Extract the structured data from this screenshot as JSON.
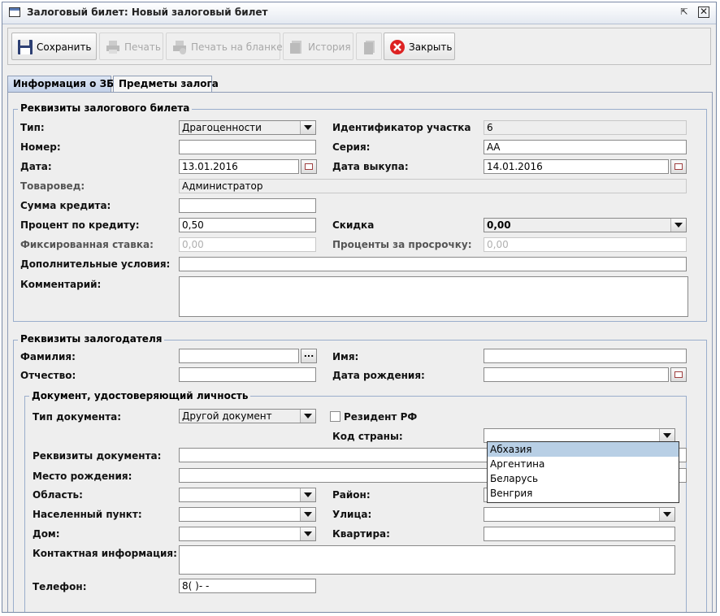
{
  "window": {
    "title": "Залоговый билет:  Новый залоговый билет"
  },
  "toolbar": {
    "save": "Сохранить",
    "print": "Печать",
    "print_form": "Печать на бланке",
    "history": "История",
    "close": "Закрыть"
  },
  "tabs": [
    "Информация о ЗБ",
    "Предметы залога"
  ],
  "ticket": {
    "legend": "Реквизиты залогового билета",
    "type_label": "Тип:",
    "type_value": "Драгоценности",
    "site_label": "Идентификатор участка",
    "site_value": "6",
    "number_label": "Номер:",
    "number_value": "",
    "series_label": "Серия:",
    "series_value": "АА",
    "date_label": "Дата:",
    "date_value": "13.01.2016",
    "buyback_label": "Дата выкупа:",
    "buyback_value": "14.01.2016",
    "merch_label": "Товаровед:",
    "merch_value": "Администратор",
    "credit_label": "Сумма кредита:",
    "credit_value": "",
    "percent_label": "Процент по кредиту:",
    "percent_value": "0,50",
    "discount_label": "Скидка",
    "discount_value": "0,00",
    "fixed_label": "Фиксированная ставка:",
    "fixed_value": "0,00",
    "overdue_label": "Проценты за просрочку:",
    "overdue_value": "0,00",
    "extra_label": "Дополнительные условия:",
    "extra_value": "",
    "comment_label": "Комментарий:",
    "comment_value": ""
  },
  "pledger": {
    "legend": "Реквизиты залогодателя",
    "surname_label": "Фамилия:",
    "surname_value": "",
    "lookup_label": "...",
    "name_label": "Имя:",
    "name_value": "",
    "patronymic_label": "Отчество:",
    "patronymic_value": "",
    "birth_label": "Дата рождения:",
    "birth_value": "",
    "doc": {
      "legend": "Документ, удостоверяющий личность",
      "doctype_label": "Тип документа:",
      "doctype_value": "Другой документ",
      "resident_label": "Резидент РФ",
      "country_label": "Код страны:",
      "country_value": "",
      "country_options": [
        "Абхазия",
        "Аргентина",
        "Беларусь",
        "Венгрия"
      ],
      "details_label": "Реквизиты документа:",
      "details_value": "",
      "birthplace_label": "Место рождения:",
      "birthplace_value": "",
      "region_label": "Область:",
      "region_value": "",
      "district_label": "Район:",
      "district_value": "",
      "locality_label": "Населенный пункт:",
      "locality_value": "",
      "street_label": "Улица:",
      "street_value": "",
      "house_label": "Дом:",
      "house_value": "",
      "apartment_label": "Квартира:",
      "apartment_value": "",
      "contact_label": "Контактная информация:",
      "contact_value": "",
      "phone_label": "Телефон:",
      "phone_value": "8(   )-   -"
    }
  }
}
